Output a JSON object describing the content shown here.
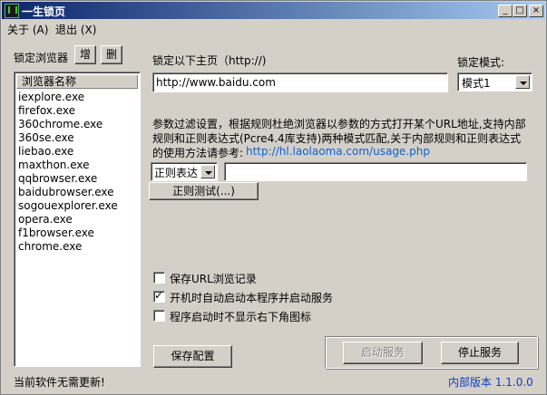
{
  "window": {
    "title": "一生锁页"
  },
  "menu": [
    "关于 (A)",
    "退出 (X)"
  ],
  "sidebar": {
    "lock_label": "锁定浏览器",
    "add_button": "增",
    "delete_button": "删",
    "list_header": "浏览器名称",
    "browsers": [
      "iexplore.exe",
      "firefox.exe",
      "360chrome.exe",
      "360se.exe",
      "liebao.exe",
      "maxthon.exe",
      "qqbrowser.exe",
      "baidubrowser.exe",
      "sogouexplorer.exe",
      "opera.exe",
      "f1browser.exe",
      "chrome.exe"
    ]
  },
  "homepage": {
    "label": "锁定以下主页（http://)",
    "value": "http://www.baidu.com",
    "mode_label": "锁定模式:",
    "mode_value": "模式1"
  },
  "filter": {
    "desc1": "参数过滤设置，根据规则杜绝浏览器以参数的方式打开某个URL地址,支持内部",
    "desc2": "规则和正则表达式(Pcre4.4库支持)两种模式匹配,关于内部规则和正则表达式",
    "desc3": "的使用方法请参考:",
    "link": "http://hl.laolaoma.com/usage.php",
    "type_value": "正则表达",
    "pattern_value": "",
    "test_button": "正则测试(...)"
  },
  "options": [
    {
      "label": "保存URL浏览记录",
      "checked": false
    },
    {
      "label": "开机时自动启动本程序并启动服务",
      "checked": true
    },
    {
      "label": "程序启动时不显示右下角图标",
      "checked": false
    }
  ],
  "buttons": {
    "save": "保存配置",
    "start": "启动服务",
    "stop": "停止服务"
  },
  "status": {
    "left": "当前软件无需更新!",
    "right": "内部版本 1.1.0.0"
  }
}
